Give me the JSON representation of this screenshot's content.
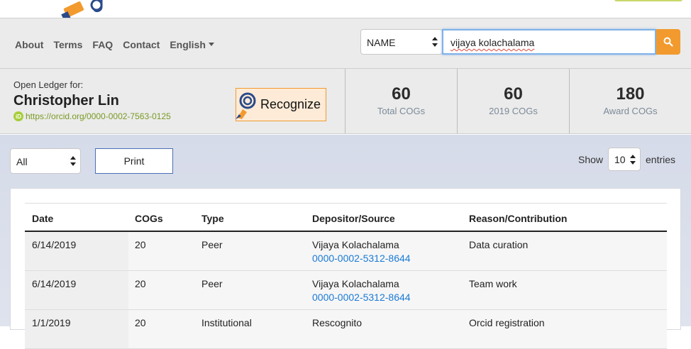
{
  "nav": {
    "links": [
      "About",
      "Terms",
      "FAQ",
      "Contact"
    ],
    "language": "English"
  },
  "search": {
    "type_selected": "NAME",
    "query": "vijaya kolachalama"
  },
  "ledger": {
    "label": "Open Ledger for:",
    "name": "Christopher Lin",
    "orcid_url": "https://orcid.org/0000-0002-7563-0125",
    "orcid_badge": "iD",
    "recognize_label": "Recognize"
  },
  "stats": [
    {
      "value": "60",
      "label": "Total COGs"
    },
    {
      "value": "60",
      "label": "2019 COGs"
    },
    {
      "value": "180",
      "label": "Award COGs"
    }
  ],
  "controls": {
    "filter_selected": "All",
    "print_label": "Print",
    "show_label": "Show",
    "entries_value": "10",
    "entries_label": "entries"
  },
  "table": {
    "headers": [
      "Date",
      "COGs",
      "Type",
      "Depositor/Source",
      "Reason/Contribution"
    ],
    "rows": [
      {
        "date": "6/14/2019",
        "cogs": "20",
        "type": "Peer",
        "depositor": "Vijaya Kolachalama",
        "depositor_id": "0000-0002-5312-8644",
        "reason": "Data curation"
      },
      {
        "date": "6/14/2019",
        "cogs": "20",
        "type": "Peer",
        "depositor": "Vijaya Kolachalama",
        "depositor_id": "0000-0002-5312-8644",
        "reason": "Team work"
      },
      {
        "date": "1/1/2019",
        "cogs": "20",
        "type": "Institutional",
        "depositor": "Rescognito",
        "depositor_id": "",
        "reason": "Orcid registration"
      }
    ]
  },
  "colors": {
    "accent_orange": "#f29a2e",
    "link_blue": "#1a7ad6",
    "orcid_green": "#a6ce39"
  }
}
